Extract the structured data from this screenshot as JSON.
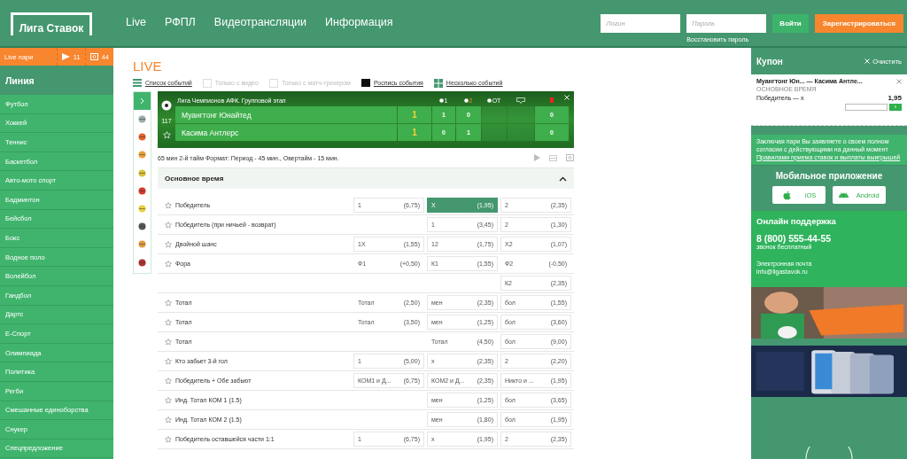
{
  "header": {
    "logo": "Лига Ставок",
    "nav": [
      "Live",
      "РФПЛ",
      "Видеотрансляции",
      "Информация"
    ],
    "login": {
      "placeholder": "Логин"
    },
    "password": {
      "placeholder": "Пароль"
    },
    "restore": "Восстановить пароль",
    "login_button": "Войти",
    "register_button": "Зарегистрироваться"
  },
  "sidebar": {
    "live": {
      "label": "Live пари",
      "play_count": "11",
      "tv_count": "44"
    },
    "title": "Линия",
    "items": [
      "Футбол",
      "Хоккей",
      "Теннис",
      "Баскетбол",
      "Авто-мото спорт",
      "Бадминтон",
      "Бейсбол",
      "Бокс",
      "Водное поло",
      "Волейбол",
      "Гандбол",
      "Дартс",
      "E-Спорт",
      "Олимпиада",
      "Политика",
      "Регби",
      "Смешанные единоборства",
      "Снукер",
      "Спецпредложение"
    ]
  },
  "main": {
    "title": "LIVE",
    "filters": [
      {
        "kind": "list",
        "label": "Список событий",
        "disabled": false
      },
      {
        "kind": "checkbox",
        "label": "Только с видео",
        "disabled": true
      },
      {
        "kind": "checkbox",
        "label": "Только с матч-трекером",
        "disabled": true
      },
      {
        "kind": "bars",
        "label": "Роспись события",
        "disabled": false
      },
      {
        "kind": "grid",
        "label": "Несколько событий",
        "disabled": false
      }
    ],
    "scoreboard": {
      "league": "Лига Чемпионов АФК. Групповой этап",
      "minute": "117",
      "columns": [
        {
          "kind": "yellow"
        },
        {
          "kind": "period",
          "label": "1",
          "current": false
        },
        {
          "kind": "period",
          "label": "2",
          "current": true
        },
        {
          "kind": "period",
          "label": "ОТ",
          "current": false
        },
        {
          "kind": "corners"
        },
        {
          "kind": "red"
        }
      ],
      "teams": [
        {
          "name": "Муангтонг Юнайтед",
          "yellow_cards": "1",
          "periods": [
            "1",
            "0"
          ],
          "red_cards": "0"
        },
        {
          "name": "Касима Антлерс",
          "yellow_cards": "1",
          "periods": [
            "0",
            "1"
          ],
          "red_cards": "0"
        }
      ]
    },
    "info": "65 мин 2-й тайм Формат: Период - 45 мин., Овертайм - 15 мин.",
    "section": {
      "title": "Основное время",
      "expanded": true
    },
    "markets": [
      {
        "name": "Победитель",
        "cells": [
          {
            "label": "1",
            "odds": "(6,75)",
            "boxed": true,
            "selected": false
          },
          {
            "label": "X",
            "odds": "(1,95)",
            "boxed": true,
            "selected": true
          },
          {
            "label": "2",
            "odds": "(2,35)",
            "boxed": true,
            "selected": false
          }
        ]
      },
      {
        "name": "Победитель (при ничьей - возврат)",
        "cells": [
          null,
          {
            "label": "1",
            "odds": "(3,45)",
            "boxed": true,
            "selected": false
          },
          {
            "label": "2",
            "odds": "(1,30)",
            "boxed": true,
            "selected": false
          }
        ]
      },
      {
        "name": "Двойной шанс",
        "cells": [
          {
            "label": "1X",
            "odds": "(1,55)",
            "boxed": true,
            "selected": false
          },
          {
            "label": "12",
            "odds": "(1,75)",
            "boxed": true,
            "selected": false
          },
          {
            "label": "X2",
            "odds": "(1,07)",
            "boxed": true,
            "selected": false
          }
        ]
      },
      {
        "name": "Фора",
        "cells": [
          {
            "label": "Ф1",
            "odds": "(+0,50)",
            "boxed": false,
            "selected": false
          },
          {
            "label": "К1",
            "odds": "(1,55)",
            "boxed": true,
            "selected": false
          },
          {
            "label": "Ф2",
            "odds": "(-0,50)",
            "boxed": false,
            "selected": false
          }
        ]
      },
      {
        "cells": [
          null,
          null,
          {
            "label": "К2",
            "odds": "(2,35)",
            "boxed": true,
            "selected": false
          }
        ]
      },
      {
        "name": "Тотал",
        "cells": [
          {
            "label": "Тотал",
            "odds": "(2,50)",
            "boxed": false,
            "selected": false
          },
          {
            "label": "мен",
            "odds": "(2,35)",
            "boxed": true,
            "selected": false
          },
          {
            "label": "бол",
            "odds": "(1,55)",
            "boxed": true,
            "selected": false
          }
        ]
      },
      {
        "name": "Тотал",
        "cells": [
          {
            "label": "Тотал",
            "odds": "(3,50)",
            "boxed": false,
            "selected": false
          },
          {
            "label": "мен",
            "odds": "(1,25)",
            "boxed": true,
            "selected": false
          },
          {
            "label": "бол",
            "odds": "(3,60)",
            "boxed": true,
            "selected": false
          }
        ]
      },
      {
        "name": "Тотал",
        "cells": [
          null,
          {
            "label": "Тотал",
            "odds": "(4,50)",
            "boxed": false,
            "selected": false
          },
          {
            "label": "бол",
            "odds": "(9,00)",
            "boxed": true,
            "selected": false
          }
        ]
      },
      {
        "name": "Кто забьет 3-й гол",
        "cells": [
          {
            "label": "1",
            "odds": "(5,00)",
            "boxed": true,
            "selected": false
          },
          {
            "label": "х",
            "odds": "(2,35)",
            "boxed": true,
            "selected": false
          },
          {
            "label": "2",
            "odds": "(2,20)",
            "boxed": true,
            "selected": false
          }
        ]
      },
      {
        "name": "Победитель + Обе забьют",
        "cells": [
          {
            "label": "КОМ1 и Д...",
            "odds": "(6,75)",
            "boxed": true,
            "selected": false
          },
          {
            "label": "КОМ2 и Д...",
            "odds": "(2,35)",
            "boxed": true,
            "selected": false
          },
          {
            "label": "Никто и ...",
            "odds": "(1,95)",
            "boxed": true,
            "selected": false
          }
        ]
      },
      {
        "name": "Инд. Тотал КОМ 1 (1.5)",
        "cells": [
          null,
          {
            "label": "мен",
            "odds": "(1,25)",
            "boxed": true,
            "selected": false
          },
          {
            "label": "бол",
            "odds": "(3,65)",
            "boxed": true,
            "selected": false
          }
        ]
      },
      {
        "name": "Инд. Тотал КОМ 2 (1.5)",
        "cells": [
          null,
          {
            "label": "мен",
            "odds": "(1,80)",
            "boxed": true,
            "selected": false
          },
          {
            "label": "бол",
            "odds": "(1,95)",
            "boxed": true,
            "selected": false
          }
        ]
      },
      {
        "name": "Победитель оставшейся части 1:1",
        "cells": [
          {
            "label": "1",
            "odds": "(6,75)",
            "boxed": true,
            "selected": false
          },
          {
            "label": "х",
            "odds": "(1,95)",
            "boxed": true,
            "selected": false
          },
          {
            "label": "2",
            "odds": "(2,35)",
            "boxed": true,
            "selected": false
          }
        ]
      }
    ]
  },
  "coupon": {
    "title": "Купон",
    "clear": "Очистить",
    "match": "Муангтонг Юн... — Касима Антле...",
    "period": "ОСНОВНОЕ ВРЕМЯ",
    "bet": "Победитель — х",
    "odds": "1,95",
    "submit": "›"
  },
  "disclaimer": {
    "text": "Заключая пари Вы заявляете о своем полном согласии с действующими на данный момент",
    "link": "Правилами приема ставок и выплаты выигрышей"
  },
  "mobile": {
    "title": "Мобильное приложение",
    "buttons": [
      {
        "kind": "ios",
        "label": "iOS"
      },
      {
        "kind": "android",
        "label": "Android"
      }
    ]
  },
  "support": {
    "title": "Онлайн поддержка",
    "phone": "8 (800) 555-44-55",
    "phone_note": "звонок бесплатный",
    "email_label": "Электронная почта",
    "email": "info@ligastavok.ru"
  }
}
